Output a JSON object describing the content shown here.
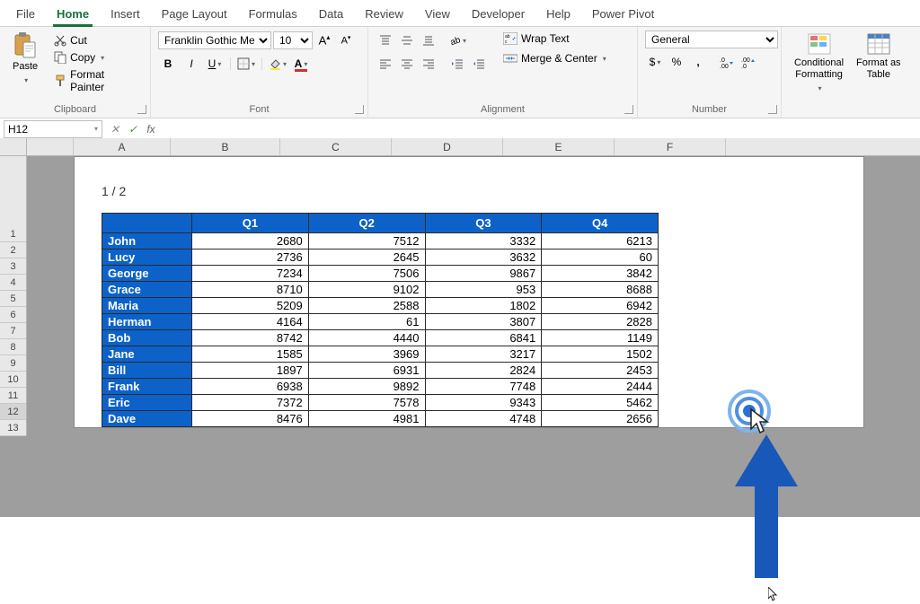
{
  "tabs": [
    "File",
    "Home",
    "Insert",
    "Page Layout",
    "Formulas",
    "Data",
    "Review",
    "View",
    "Developer",
    "Help",
    "Power Pivot"
  ],
  "active_tab": "Home",
  "clipboard": {
    "paste": "Paste",
    "cut": "Cut",
    "copy": "Copy",
    "format_painter": "Format Painter",
    "label": "Clipboard"
  },
  "font": {
    "family": "Franklin Gothic Me",
    "size": "10",
    "label": "Font"
  },
  "alignment": {
    "wrap": "Wrap Text",
    "merge": "Merge & Center",
    "label": "Alignment"
  },
  "number": {
    "format": "General",
    "label": "Number"
  },
  "styles": {
    "conditional": "Conditional\nFormatting",
    "format_table": "Format as\nTable"
  },
  "name_box": "H12",
  "columns": [
    {
      "letter": "",
      "w": 52
    },
    {
      "letter": "A",
      "w": 108
    },
    {
      "letter": "B",
      "w": 122
    },
    {
      "letter": "C",
      "w": 124
    },
    {
      "letter": "D",
      "w": 124
    },
    {
      "letter": "E",
      "w": 124
    },
    {
      "letter": "F",
      "w": 124
    }
  ],
  "row_count": 13,
  "selected_row": 12,
  "page_indicator": "1 / 2",
  "headers": [
    "",
    "Q1",
    "Q2",
    "Q3",
    "Q4"
  ],
  "rows": [
    {
      "name": "John",
      "q": [
        2680,
        7512,
        3332,
        6213
      ]
    },
    {
      "name": "Lucy",
      "q": [
        2736,
        2645,
        3632,
        60
      ]
    },
    {
      "name": "George",
      "q": [
        7234,
        7506,
        9867,
        3842
      ]
    },
    {
      "name": "Grace",
      "q": [
        8710,
        9102,
        953,
        8688
      ]
    },
    {
      "name": "Maria",
      "q": [
        5209,
        2588,
        1802,
        6942
      ]
    },
    {
      "name": "Herman",
      "q": [
        4164,
        61,
        3807,
        2828
      ]
    },
    {
      "name": "Bob",
      "q": [
        8742,
        4440,
        6841,
        1149
      ]
    },
    {
      "name": "Jane",
      "q": [
        1585,
        3969,
        3217,
        1502
      ]
    },
    {
      "name": "Bill",
      "q": [
        1897,
        6931,
        2824,
        2453
      ]
    },
    {
      "name": "Frank",
      "q": [
        6938,
        9892,
        7748,
        2444
      ]
    },
    {
      "name": "Eric",
      "q": [
        7372,
        7578,
        9343,
        5462
      ]
    },
    {
      "name": "Dave",
      "q": [
        8476,
        4981,
        4748,
        2656
      ]
    }
  ],
  "colors": {
    "accent": "#0d62c9",
    "ribbon_green": "#1a6f3f"
  }
}
